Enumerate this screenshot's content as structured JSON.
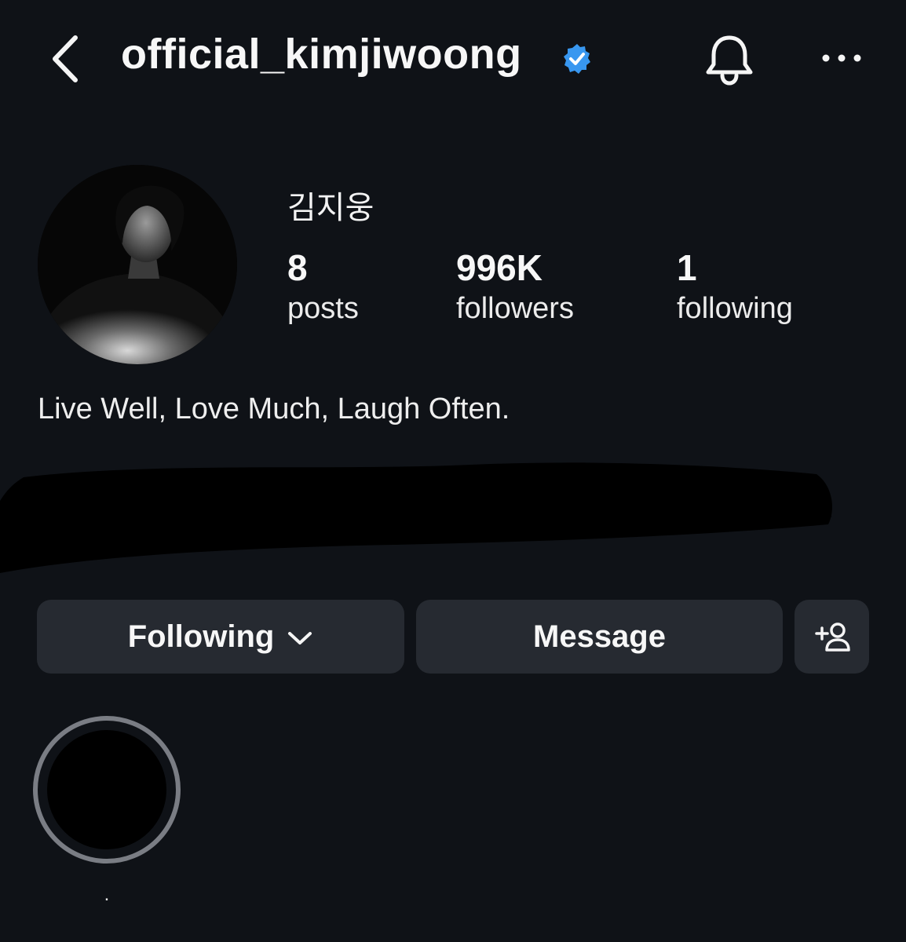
{
  "header": {
    "username": "official_kimjiwoong",
    "verified": true,
    "icons": [
      "back-chevron-icon",
      "verified-badge-icon",
      "bell-icon",
      "more-icon"
    ],
    "verified_color": "#3897f0"
  },
  "profile": {
    "display_name": "김지웅",
    "stats": [
      {
        "value": "8",
        "label": "posts"
      },
      {
        "value": "996K",
        "label": "followers"
      },
      {
        "value": "1",
        "label": "following"
      }
    ],
    "bio": "Live Well, Love Much, Laugh Often."
  },
  "actions": {
    "following_label": "Following",
    "message_label": "Message",
    "add_user_icon": "add-user-icon"
  },
  "highlights": [
    {
      "label": "."
    }
  ],
  "colors": {
    "background": "#0f1217",
    "button": "#262a31",
    "text": "#f5f5f5"
  }
}
